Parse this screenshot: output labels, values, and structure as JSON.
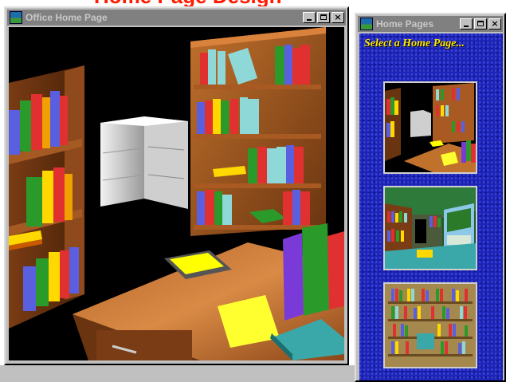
{
  "page_heading": "Home Page Design",
  "windows": {
    "office": {
      "title": "Office Home Page",
      "controls": {
        "minimize": "minimize",
        "maximize": "maximize",
        "close": "×"
      }
    },
    "home_pages": {
      "title": "Home Pages",
      "caption": "Select a Home Page...",
      "controls": {
        "minimize": "minimize",
        "maximize": "maximize",
        "close": "×"
      },
      "thumbnails": [
        {
          "name": "office-scene-thumbnail"
        },
        {
          "name": "library-room-thumbnail"
        },
        {
          "name": "bookshelf-wall-thumbnail"
        }
      ]
    }
  },
  "colors": {
    "title_inactive": "#808080",
    "home_pages_background": "#1c24b8",
    "caption": "#ffe800",
    "heading": "#ff1a00"
  }
}
